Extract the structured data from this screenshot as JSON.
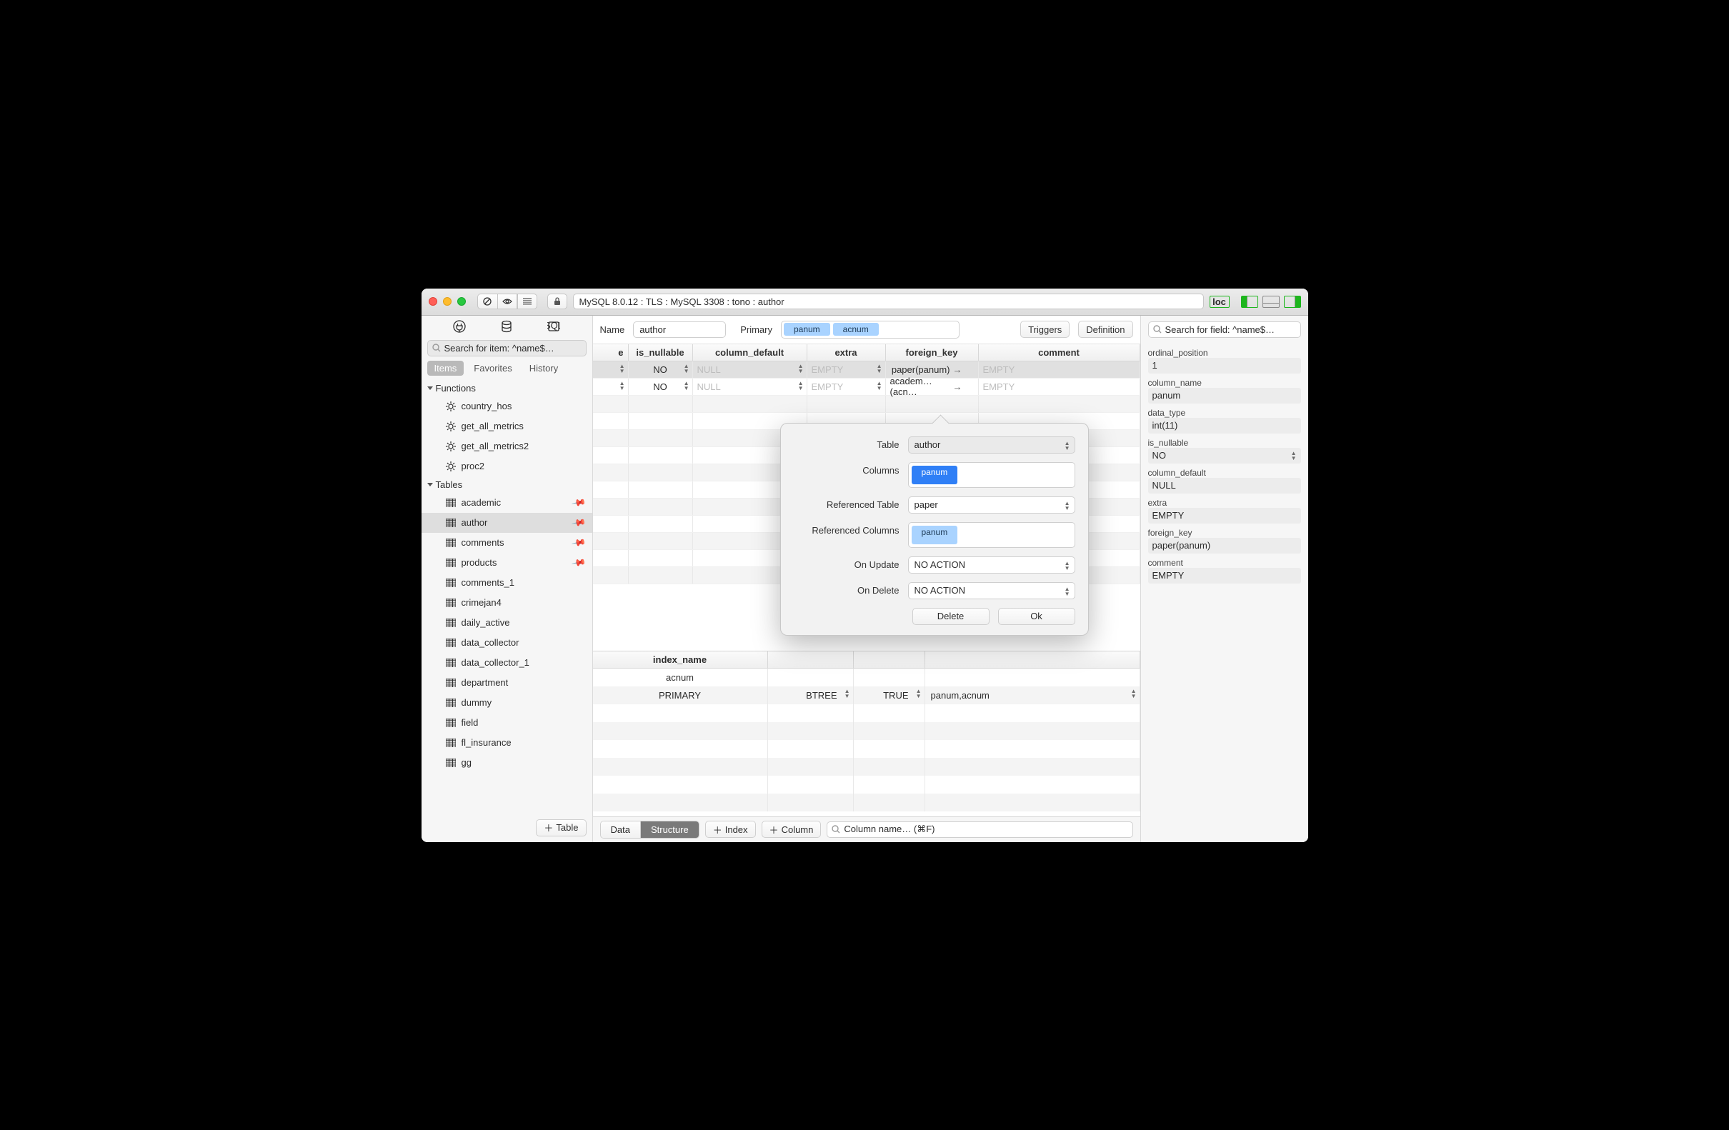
{
  "titlebar": {
    "breadcrumb": "MySQL 8.0.12  :  TLS  :  MySQL 3308  :  tono  :  author",
    "status_badge": "loc"
  },
  "sidebar": {
    "search_placeholder": "Search for item: ^name$…",
    "tabs": [
      "Items",
      "Favorites",
      "History"
    ],
    "active_tab": 0,
    "groups": [
      {
        "name": "Functions",
        "expanded": true,
        "kind": "func",
        "items": [
          {
            "label": "country_hos"
          },
          {
            "label": "get_all_metrics"
          },
          {
            "label": "get_all_metrics2"
          },
          {
            "label": "proc2"
          }
        ]
      },
      {
        "name": "Tables",
        "expanded": true,
        "kind": "table",
        "items": [
          {
            "label": "academic",
            "pinned": true
          },
          {
            "label": "author",
            "pinned": true,
            "selected": true
          },
          {
            "label": "comments",
            "pinned": true
          },
          {
            "label": "products",
            "pinned": true
          },
          {
            "label": "comments_1"
          },
          {
            "label": "crimejan4"
          },
          {
            "label": "daily_active"
          },
          {
            "label": "data_collector"
          },
          {
            "label": "data_collector_1"
          },
          {
            "label": "department"
          },
          {
            "label": "dummy"
          },
          {
            "label": "field"
          },
          {
            "label": "fl_insurance"
          },
          {
            "label": "gg"
          }
        ]
      }
    ],
    "add_button": "Table"
  },
  "header": {
    "name_label": "Name",
    "name_value": "author",
    "primary_label": "Primary",
    "primary_keys": [
      "panum",
      "acnum"
    ],
    "triggers_btn": "Triggers",
    "definition_btn": "Definition"
  },
  "columns": {
    "headers": [
      "e",
      "is_nullable",
      "column_default",
      "extra",
      "foreign_key",
      "comment"
    ],
    "rows": [
      {
        "is_nullable": "NO",
        "column_default": "NULL",
        "extra": "EMPTY",
        "foreign_key": "paper(panum)",
        "comment": "EMPTY",
        "selected": true
      },
      {
        "is_nullable": "NO",
        "column_default": "NULL",
        "extra": "EMPTY",
        "foreign_key": "academ…(acn…",
        "comment": "EMPTY"
      }
    ]
  },
  "indexes": {
    "headers": [
      "index_name",
      "",
      "",
      ""
    ],
    "rows": [
      {
        "name": "acnum",
        "alg": "",
        "uniq": "",
        "cols": ""
      },
      {
        "name": "PRIMARY",
        "alg": "BTREE",
        "uniq": "TRUE",
        "cols": "panum,acnum"
      }
    ]
  },
  "bottombar": {
    "segments": [
      "Data",
      "Structure"
    ],
    "active_segment": 1,
    "add_index": "Index",
    "add_column": "Column",
    "filter_placeholder": "Column name… (⌘F)"
  },
  "inspector": {
    "search_placeholder": "Search for field: ^name$…",
    "fields": [
      {
        "label": "ordinal_position",
        "value": "1"
      },
      {
        "label": "column_name",
        "value": "panum"
      },
      {
        "label": "data_type",
        "value": "int(11)"
      },
      {
        "label": "is_nullable",
        "value": "NO",
        "select": true
      },
      {
        "label": "column_default",
        "value": "NULL",
        "placeholder": true
      },
      {
        "label": "extra",
        "value": "EMPTY",
        "placeholder": true
      },
      {
        "label": "foreign_key",
        "value": "paper(panum)"
      },
      {
        "label": "comment",
        "value": "EMPTY",
        "placeholder": true
      }
    ]
  },
  "popover": {
    "table_lbl": "Table",
    "table_val": "author",
    "cols_lbl": "Columns",
    "cols": [
      "panum"
    ],
    "reftbl_lbl": "Referenced Table",
    "reftbl_val": "paper",
    "refcols_lbl": "Referenced Columns",
    "refcols": [
      "panum"
    ],
    "onupd_lbl": "On Update",
    "onupd_val": "NO ACTION",
    "ondel_lbl": "On Delete",
    "ondel_val": "NO ACTION",
    "delete_btn": "Delete",
    "ok_btn": "Ok"
  }
}
